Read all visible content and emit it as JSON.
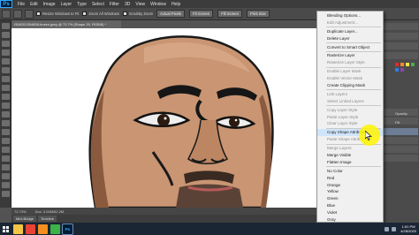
{
  "app": {
    "logo": "Ps"
  },
  "menubar": {
    "items": [
      "File",
      "Edit",
      "Image",
      "Layer",
      "Type",
      "Select",
      "Filter",
      "3D",
      "View",
      "Window",
      "Help"
    ]
  },
  "options": {
    "checks": [
      "Resize Windows to Fit",
      "Zoom All Windows",
      "Scrubby Zoom"
    ],
    "buttons": [
      "Actual Pixels",
      "Fit Screen",
      "Fill Screen",
      "Print Size"
    ]
  },
  "document": {
    "tab_title": "f306201354858-bozen.jpeg @ 72.7% (Shape 20, RGB/8) *"
  },
  "status": {
    "zoom": "72.73%",
    "doc": "Doc: 3.00M/62.2M"
  },
  "minibridge": {
    "tabs": [
      "Mini Bridge",
      "Timeline"
    ]
  },
  "context_menu": {
    "items": [
      {
        "label": "Blending Options...",
        "disabled": false
      },
      {
        "label": "Edit Adjustment...",
        "disabled": true
      },
      {
        "sep": true
      },
      {
        "label": "Duplicate Layer...",
        "disabled": false
      },
      {
        "label": "Delete Layer",
        "disabled": false
      },
      {
        "sep": true
      },
      {
        "label": "Convert to Smart Object",
        "disabled": false
      },
      {
        "sep": true
      },
      {
        "label": "Rasterize Layer",
        "disabled": false
      },
      {
        "label": "Rasterize Layer Style",
        "disabled": true
      },
      {
        "sep": true
      },
      {
        "label": "Enable Layer Mask",
        "disabled": true
      },
      {
        "label": "Enable Vector Mask",
        "disabled": true
      },
      {
        "label": "Create Clipping Mask",
        "disabled": false
      },
      {
        "sep": true
      },
      {
        "label": "Link Layers",
        "disabled": true
      },
      {
        "label": "Select Linked Layers",
        "disabled": true
      },
      {
        "sep": true
      },
      {
        "label": "Copy Layer Style",
        "disabled": true
      },
      {
        "label": "Paste Layer Style",
        "disabled": true
      },
      {
        "label": "Clear Layer Style",
        "disabled": true
      },
      {
        "sep": true
      },
      {
        "label": "Copy Shape Attributes",
        "disabled": false,
        "highlighted": true
      },
      {
        "label": "Paste Shape Attributes",
        "disabled": true
      },
      {
        "sep": true
      },
      {
        "label": "Merge Layers",
        "disabled": true
      },
      {
        "label": "Merge Visible",
        "disabled": false
      },
      {
        "label": "Flatten Image",
        "disabled": false
      },
      {
        "sep": true
      },
      {
        "label": "No Color",
        "disabled": false
      },
      {
        "label": "Red",
        "disabled": false
      },
      {
        "label": "Orange",
        "disabled": false
      },
      {
        "label": "Yellow",
        "disabled": false
      },
      {
        "label": "Green",
        "disabled": false
      },
      {
        "label": "Blue",
        "disabled": false
      },
      {
        "label": "Violet",
        "disabled": false
      },
      {
        "label": "Gray",
        "disabled": false
      }
    ]
  },
  "right_panel": {
    "tab_top": "Adjustments",
    "fields": [
      "Opacity:",
      "Fill:"
    ],
    "swatch_colors": [
      "#e8262a",
      "#f28c28",
      "#f5e04a",
      "#4cae4f",
      "#2b7de9",
      "#8e44ad"
    ]
  },
  "taskbar": {
    "apps": [
      {
        "name": "file-explorer",
        "glyph": "",
        "color": "#f4c542"
      },
      {
        "name": "browser",
        "glyph": "",
        "color": "#e94335"
      },
      {
        "name": "media",
        "glyph": "",
        "color": "#f58f1f"
      },
      {
        "name": "camtasia",
        "glyph": "",
        "color": "#3cb34a"
      },
      {
        "name": "photoshop",
        "glyph": "Ps",
        "color": "#001d34"
      }
    ],
    "time": "1:51 PM",
    "date": "4/28/2020"
  },
  "colors": {
    "highlight": "#fff500",
    "menu_bg": "#f0f0f0",
    "menu_hover": "#cfe5fb"
  }
}
